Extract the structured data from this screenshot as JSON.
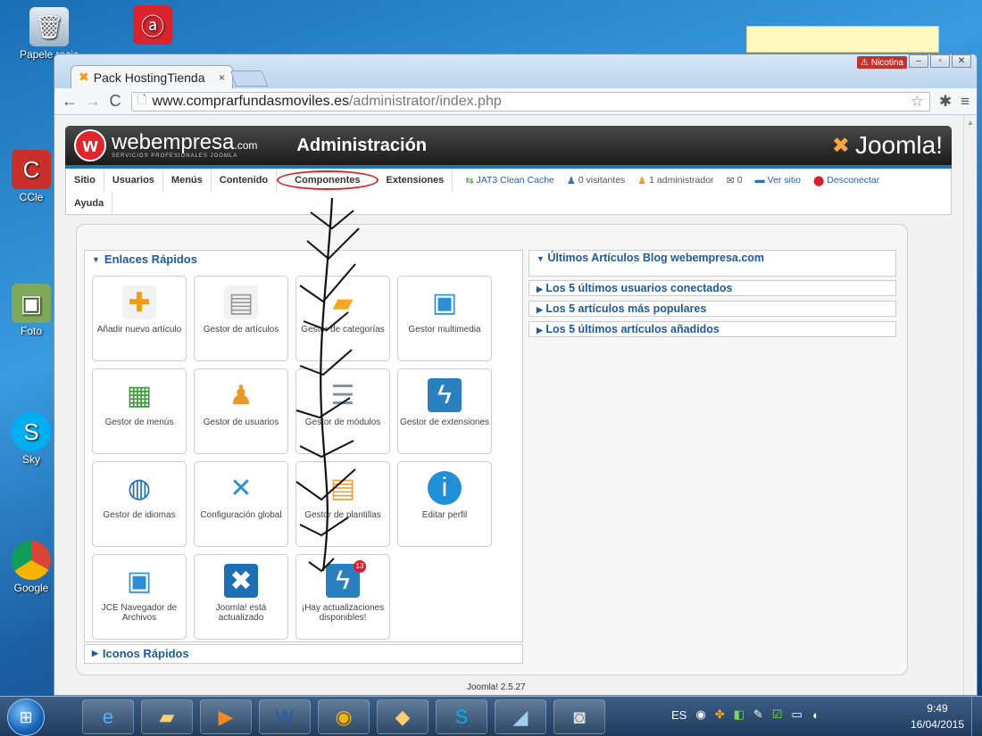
{
  "desktop": {
    "icons": [
      {
        "label": "Papelera de reciclaje",
        "short": "Papele recic",
        "icon": "recycle-bin-icon"
      },
      {
        "label": "CCleaner",
        "short": "CCle",
        "icon": "ccleaner-icon"
      },
      {
        "label": "Foto",
        "short": "Foto",
        "icon": "photo-icon"
      },
      {
        "label": "Skype",
        "short": "Sky",
        "icon": "skype-icon"
      },
      {
        "label": "Google",
        "short": "Google",
        "icon": "chrome-icon"
      }
    ]
  },
  "browser": {
    "tab_title": "Pack HostingTienda",
    "tab_close": "×",
    "profile_name": "Nicotina",
    "url_host": "www.comprarfundasmoviles.es",
    "url_path": "/administrator/index.php"
  },
  "header": {
    "brand": "webempresa",
    "brand_suffix": ".com",
    "brand_tagline": "SERVICIOS PROFESIONALES JOOMLA",
    "title": "Administración",
    "joomla_label": "Joomla!"
  },
  "menu": {
    "items": [
      "Sitio",
      "Usuarios",
      "Menús",
      "Contenido",
      "Componentes",
      "Extensiones"
    ],
    "second_row": "Ayuda",
    "status": {
      "cache": "JAT3 Clean Cache",
      "visitors": "0 visitantes",
      "admins": "1 administrador",
      "messages": "0",
      "view_site": "Ver sitio",
      "logout": "Desconectar"
    }
  },
  "quick_links": {
    "title": "Enlaces Rápidos",
    "items": [
      {
        "label": "Añadir nuevo artículo",
        "icon": "add-article-icon"
      },
      {
        "label": "Gestor de artículos",
        "icon": "articles-icon"
      },
      {
        "label": "Gestor de categorías",
        "icon": "folder-icon"
      },
      {
        "label": "Gestor multimedia",
        "icon": "media-icon"
      },
      {
        "label": "Gestor de menús",
        "icon": "menu-icon"
      },
      {
        "label": "Gestor de usuarios",
        "icon": "users-icon"
      },
      {
        "label": "Gestor de módulos",
        "icon": "modules-icon"
      },
      {
        "label": "Gestor de extensiones",
        "icon": "extensions-icon"
      },
      {
        "label": "Gestor de idiomas",
        "icon": "globe-icon"
      },
      {
        "label": "Configuración global",
        "icon": "tools-icon"
      },
      {
        "label": "Gestor de plantillas",
        "icon": "templates-icon"
      },
      {
        "label": "Editar perfil",
        "icon": "info-icon"
      },
      {
        "label": "JCE Navegador de Archivos",
        "icon": "jce-browser-icon"
      },
      {
        "label": "Joomla! está actualizado",
        "icon": "joomla-ok-icon"
      },
      {
        "label": "¡Hay actualizaciones disponibles!",
        "icon": "updates-icon",
        "badge": "13"
      }
    ],
    "icons_rapidos": "Iconos Rápidos"
  },
  "right_panels": [
    "Últimos Artículos Blog webempresa.com",
    "Los 5 últimos usuarios conectados",
    "Los 5 artículos más populares",
    "Los 5 últimos artículos añadidos"
  ],
  "footer": "Joomla! 2.5.27",
  "taskbar": {
    "lang": "ES",
    "time": "9:49",
    "date": "16/04/2015"
  }
}
